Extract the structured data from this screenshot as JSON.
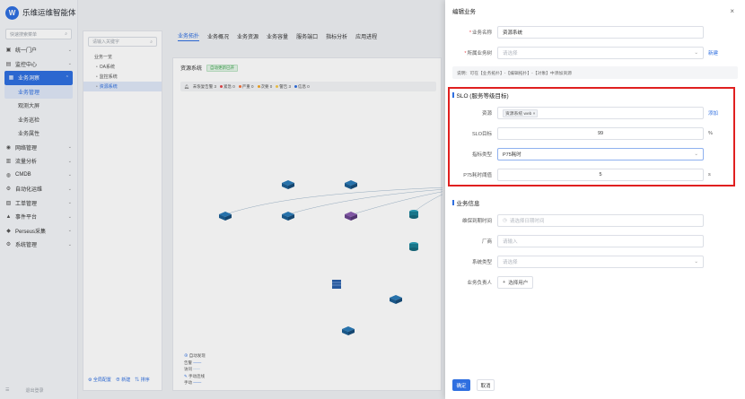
{
  "app": {
    "title": "乐维运维智能体",
    "logo_text": "W"
  },
  "sidebar": {
    "search_placeholder": "快速搜索菜单",
    "items": [
      {
        "label": "统一门户",
        "icon": "home-icon"
      },
      {
        "label": "监控中心",
        "icon": "monitor-icon"
      },
      {
        "label": "业务洞察",
        "icon": "insight-icon",
        "active": true
      },
      {
        "label": "网络管理",
        "icon": "network-icon"
      },
      {
        "label": "流量分析",
        "icon": "traffic-icon"
      },
      {
        "label": "CMDB",
        "icon": "cmdb-icon"
      },
      {
        "label": "自动化运维",
        "icon": "automation-icon"
      },
      {
        "label": "工单管理",
        "icon": "ticket-icon"
      },
      {
        "label": "事件平台",
        "icon": "event-icon"
      },
      {
        "label": "Perseus采集",
        "icon": "collect-icon"
      },
      {
        "label": "系统管理",
        "icon": "settings-icon"
      }
    ],
    "sub_items": [
      {
        "label": "业务管理",
        "active": true
      },
      {
        "label": "观测大屏"
      },
      {
        "label": "业务巡检"
      },
      {
        "label": "业务属性"
      }
    ],
    "bottom_left": "☰",
    "bottom_right": "退出登录"
  },
  "tree": {
    "search_placeholder": "请输入关键字",
    "root": "业务一览",
    "children": [
      "OA系统",
      "监控系统",
      "资源系统"
    ],
    "selected": "资源系统",
    "footer": [
      "全局配置",
      "新建",
      "排序"
    ]
  },
  "canvas": {
    "tabs": [
      "业务拓扑",
      "业务概况",
      "业务资源",
      "业务容量",
      "服务端口",
      "指标分析",
      "应用进程"
    ],
    "active_tab": "业务拓扑",
    "title": "资源系统",
    "tag": "自动更新已开",
    "legend": {
      "prefix": "未恢复告警 3",
      "levels": [
        {
          "label": "紧急 0",
          "color": "#e5484d"
        },
        {
          "label": "严重 0",
          "color": "#f5703a"
        },
        {
          "label": "次要 0",
          "color": "#f5a623"
        },
        {
          "label": "警告 3",
          "color": "#f7c948"
        },
        {
          "label": "信息 0",
          "color": "#2f6fe0"
        }
      ]
    },
    "mini_legend": {
      "auto": "自动发现",
      "alarm": "告警",
      "visit": "访问",
      "manual": "手动连线",
      "manual_line": "手动"
    }
  },
  "drawer": {
    "title": "编辑业务",
    "fields": {
      "business_name": {
        "label": "业务名称",
        "value": "资源系统"
      },
      "business_tree": {
        "label": "所属业务树",
        "placeholder": "请选择",
        "action": "新建"
      },
      "note": "说明：可在【业务拓扑】-【编辑拓扑】-【对象】中添加资源"
    },
    "slo": {
      "title": "SLO (服务等级目标)",
      "resource_label": "资源",
      "resource_chip": "资源系统 web",
      "resource_action": "添加",
      "target_label": "SLO目标",
      "target_value": "99",
      "target_unit": "%",
      "indicator_label": "指标类型",
      "indicator_value": "P75耗时",
      "threshold_label": "P75耗时阈值",
      "threshold_value": "5",
      "threshold_unit": "s"
    },
    "business_info": {
      "title": "业务信息",
      "maintenance_label": "维保到期时间",
      "maintenance_placeholder": "请选择日期时间",
      "vendor_label": "厂商",
      "vendor_placeholder": "请输入",
      "system_type_label": "系统类型",
      "system_type_placeholder": "请选择",
      "owner_label": "业务负责人",
      "owner_button": "选择用户"
    },
    "confirm": "确定",
    "cancel": "取消"
  }
}
